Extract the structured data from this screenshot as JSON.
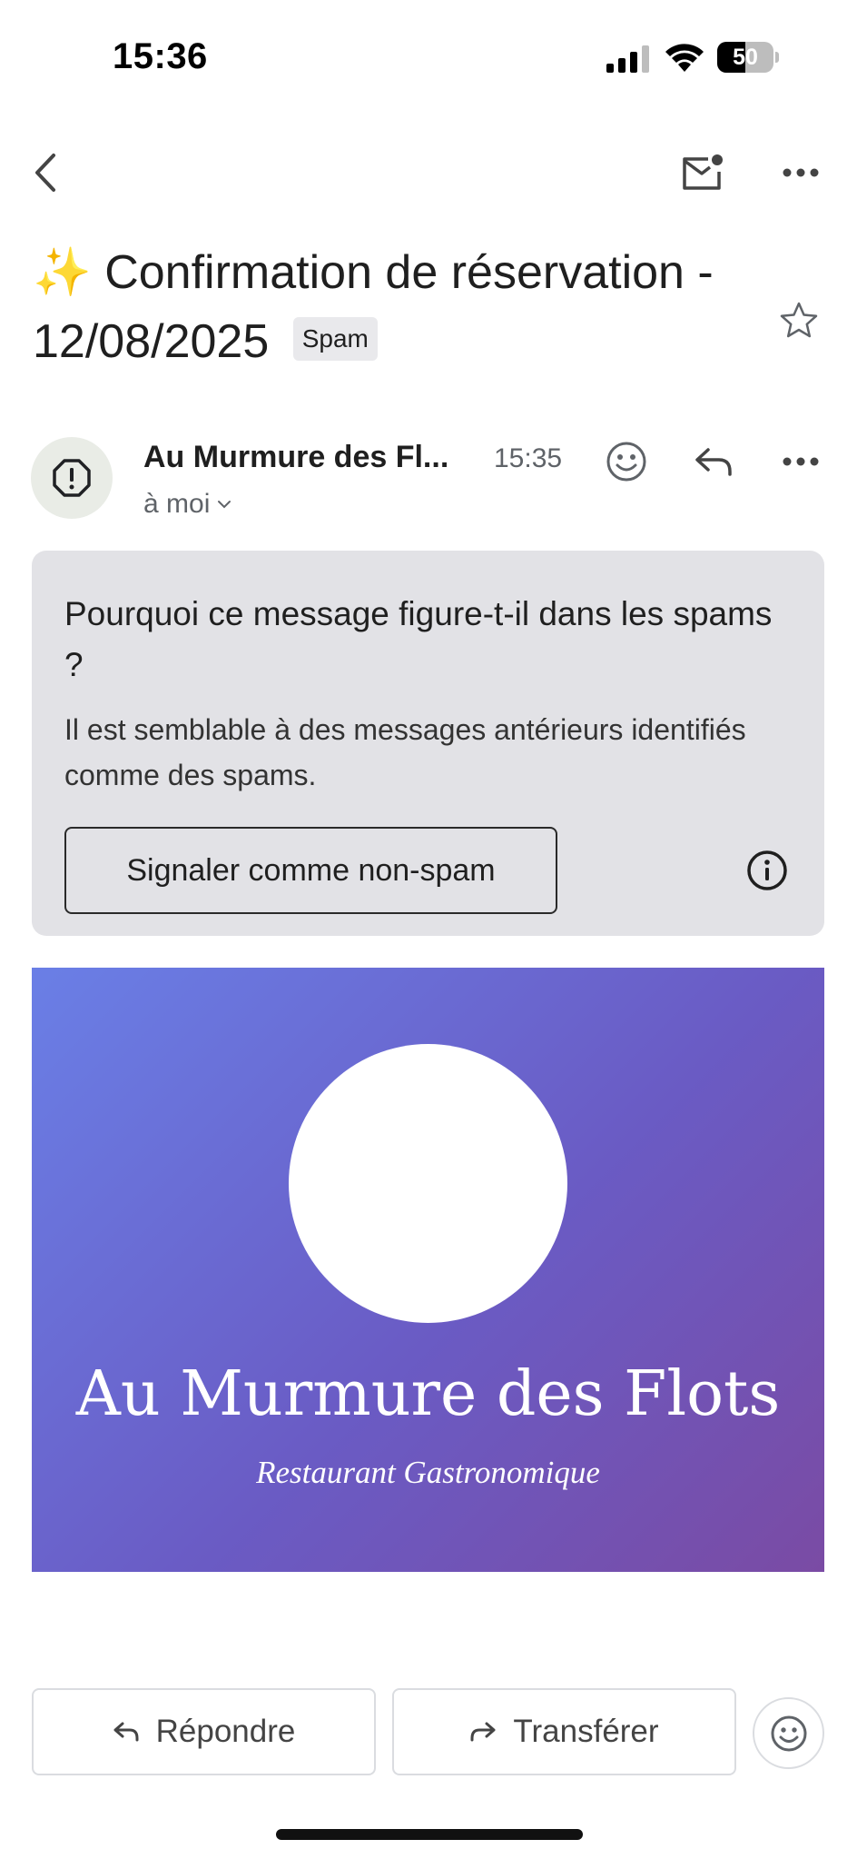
{
  "status_bar": {
    "time": "15:36",
    "battery": {
      "level_text": "50",
      "level_percent": 50
    }
  },
  "subject": {
    "emoji": "✨",
    "text": "Confirmation de réservation - 12/08/2025",
    "badge": "Spam"
  },
  "message": {
    "sender": "Au Murmure des Fl...",
    "time": "15:35",
    "recipient": "à moi"
  },
  "spam_notice": {
    "title": "Pourquoi ce message figure-t-il dans les spams ?",
    "description": "Il est semblable à des messages antérieurs identifiés comme des spams.",
    "button_label": "Signaler comme non-spam"
  },
  "banner": {
    "title": "Au Murmure des Flots",
    "subtitle": "Restaurant Gastronomique",
    "gradient_start": "#6a7fe6",
    "gradient_end": "#7a4ba4"
  },
  "actions": {
    "reply_label": "Répondre",
    "forward_label": "Transférer"
  },
  "icons": {
    "back": "chevron-left-icon",
    "mark_unread": "mail-unread-icon",
    "more": "more-horizontal-icon",
    "star": "star-outline-icon",
    "avatar": "warning-octagon-icon",
    "emoji": "emoji-smile-icon",
    "reply": "reply-icon",
    "info": "info-icon",
    "forward": "forward-icon"
  }
}
